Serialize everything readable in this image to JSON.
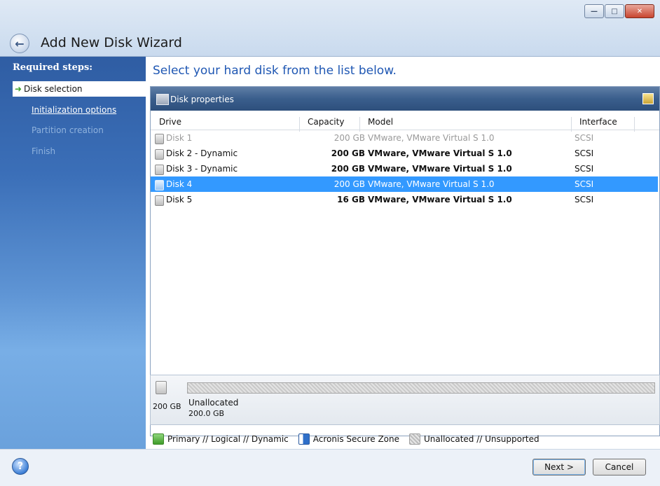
{
  "window": {
    "title": "Add New Disk Wizard",
    "buttons": {
      "minimize": "—",
      "maximize": "□",
      "close": "✕"
    }
  },
  "sidebar": {
    "header": "Required steps:",
    "items": [
      {
        "label": "Disk selection",
        "state": "active"
      },
      {
        "label": "Initialization options",
        "state": "link"
      },
      {
        "label": "Partition creation",
        "state": "disabled"
      },
      {
        "label": "Finish",
        "state": "disabled"
      }
    ]
  },
  "main": {
    "heading": "Select your hard disk from the list below.",
    "panel_title": "Disk properties",
    "columns": {
      "drive": "Drive",
      "capacity": "Capacity",
      "model": "Model",
      "interface": "Interface"
    },
    "disks": [
      {
        "drive": "Disk 1",
        "capacity": "200 GB",
        "model": "VMware, VMware Virtual S 1.0",
        "interface": "SCSI",
        "state": "disabled"
      },
      {
        "drive": "Disk 2 - Dynamic",
        "capacity": "200 GB",
        "model": "VMware, VMware Virtual S 1.0",
        "interface": "SCSI",
        "state": "normal"
      },
      {
        "drive": "Disk 3 - Dynamic",
        "capacity": "200 GB",
        "model": "VMware, VMware Virtual S 1.0",
        "interface": "SCSI",
        "state": "normal"
      },
      {
        "drive": "Disk 4",
        "capacity": "200 GB",
        "model": "VMware, VMware Virtual S 1.0",
        "interface": "SCSI",
        "state": "selected"
      },
      {
        "drive": "Disk 5",
        "capacity": "16 GB",
        "model": "VMware, VMware Virtual S 1.0",
        "interface": "SCSI",
        "state": "normal"
      }
    ],
    "diskmap": {
      "size": "200 GB",
      "partition_label": "Unallocated",
      "partition_size": "200.0 GB"
    },
    "legend": [
      {
        "label": "Primary // Logical // Dynamic",
        "color": "#4fb33a"
      },
      {
        "label": "Acronis Secure Zone",
        "color": "#2f6fc9"
      },
      {
        "label": "Unallocated // Unsupported",
        "color": "#c8c8c8"
      }
    ]
  },
  "footer": {
    "help_icon": "?",
    "next_label": "Next >",
    "cancel_label": "Cancel"
  },
  "colors": {
    "accent": "#1f57b3",
    "selection": "#3399ff",
    "sidebar": "#3b6fb8"
  }
}
